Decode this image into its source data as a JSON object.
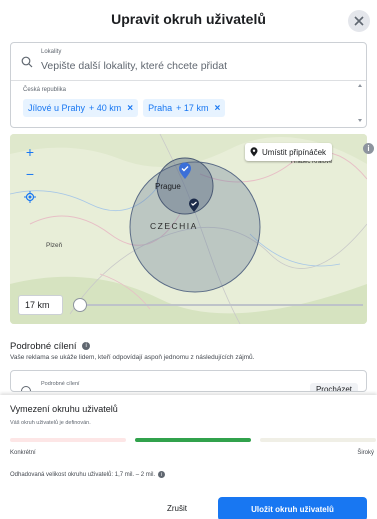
{
  "dialog": {
    "title": "Upravit okruh uživatelů"
  },
  "location": {
    "field_label": "Lokality",
    "placeholder": "Vepište další lokality, které chcete přidat",
    "country": "Česká republika",
    "chips": [
      {
        "name": "Jílové u Prahy",
        "radius": "+ 40 km"
      },
      {
        "name": "Praha",
        "radius": "+ 17 km"
      }
    ]
  },
  "map": {
    "pin_button": "Umístit připínáček",
    "labels": {
      "prague": "Prague",
      "czechia": "CZECHIA",
      "plzen": "Plzeň",
      "hradec": "Hradec Králové"
    },
    "radius_value": "17 km",
    "radius_fraction": 0.0
  },
  "detailed": {
    "title": "Podrobné cílení",
    "description": "Vaše reklama se ukáže lidem, kteří odpovídají aspoň jednomu z následujících zájmů.",
    "field_label": "Podrobné cílení",
    "browse": "Procházet"
  },
  "audience": {
    "title": "Vymezení okruhu uživatelů",
    "subtitle": "Váš okruh uživatelů je definován.",
    "left": "Konkrétní",
    "right": "Široký",
    "estimate": "Odhadovaná velikost okruhu uživatelů: 1,7 mil. – 2 mil."
  },
  "footer": {
    "cancel": "Zrušit",
    "save": "Uložit okruh uživatelů"
  },
  "colors": {
    "accent": "#1877f2",
    "good": "#31a24c"
  }
}
